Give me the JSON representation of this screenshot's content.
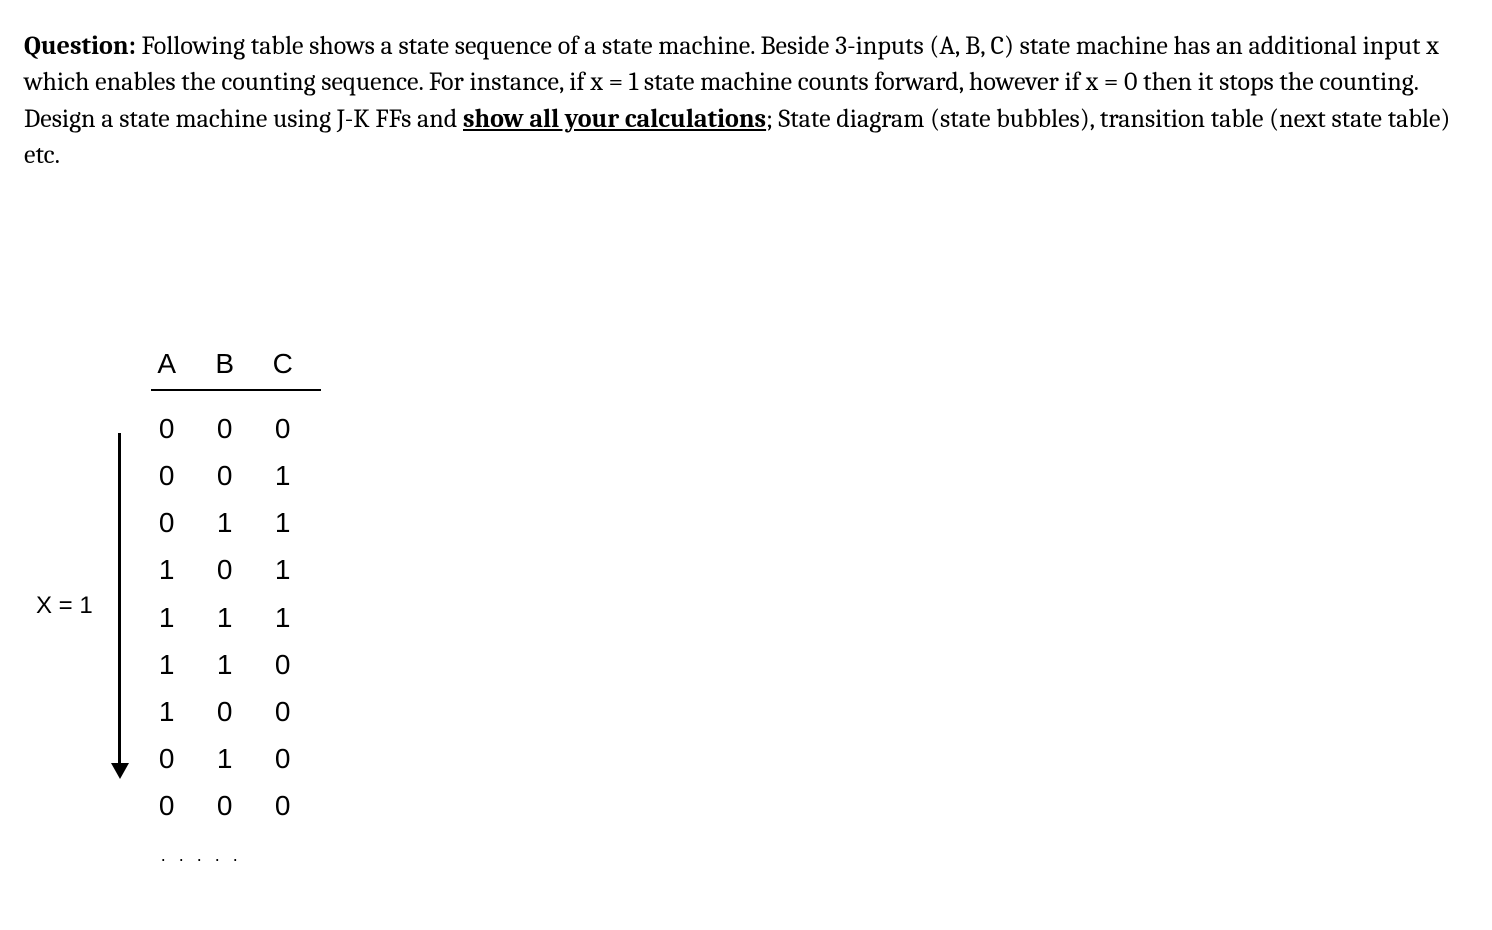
{
  "question": {
    "label": "Question:",
    "text_part1": " Following table shows a state sequence of a state machine. Beside 3-inputs (A, B, C) state machine has an additional input x which enables the counting sequence. For instance, if x = 1 state machine counts forward, however if x = 0 then it stops the counting. Design a state machine using J-K FFs and ",
    "text_bold_underline": "show all your calculations",
    "text_part2": "; State diagram (state bubbles), transition table (next state table) etc."
  },
  "sequence": {
    "x_label": "X = 1",
    "headers": {
      "a": "A",
      "b": "B",
      "c": "C"
    },
    "rows": [
      {
        "a": "0",
        "b": "0",
        "c": "0"
      },
      {
        "a": "0",
        "b": "0",
        "c": "1"
      },
      {
        "a": "0",
        "b": "1",
        "c": "1"
      },
      {
        "a": "1",
        "b": "0",
        "c": "1"
      },
      {
        "a": "1",
        "b": "1",
        "c": "1"
      },
      {
        "a": "1",
        "b": "1",
        "c": "0"
      },
      {
        "a": "1",
        "b": "0",
        "c": "0"
      },
      {
        "a": "0",
        "b": "1",
        "c": "0"
      },
      {
        "a": "0",
        "b": "0",
        "c": "0"
      }
    ],
    "continuation": ". . . . ."
  }
}
